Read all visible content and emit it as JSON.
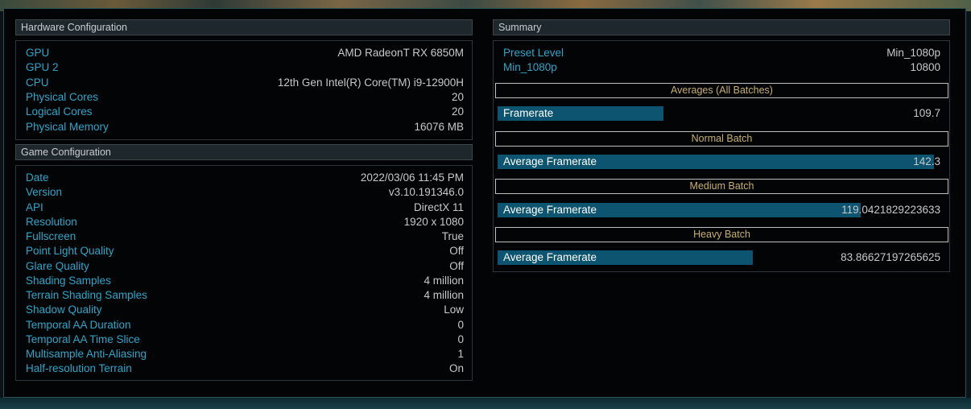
{
  "hardware": {
    "title": "Hardware Configuration",
    "rows": [
      {
        "label": "GPU",
        "value": "AMD RadeonT RX 6850M"
      },
      {
        "label": "GPU 2",
        "value": ""
      },
      {
        "label": "CPU",
        "value": "12th Gen Intel(R) Core(TM) i9-12900H"
      },
      {
        "label": "Physical Cores",
        "value": "20"
      },
      {
        "label": "Logical Cores",
        "value": "20"
      },
      {
        "label": "Physical Memory",
        "value": "16076 MB"
      }
    ]
  },
  "game": {
    "title": "Game Configuration",
    "rows": [
      {
        "label": "Date",
        "value": "2022/03/06 11:45 PM"
      },
      {
        "label": "Version",
        "value": "v3.10.191346.0"
      },
      {
        "label": "API",
        "value": "DirectX 11"
      },
      {
        "label": "Resolution",
        "value": "1920 x 1080"
      },
      {
        "label": "Fullscreen",
        "value": "True"
      },
      {
        "label": "Point Light Quality",
        "value": "Off"
      },
      {
        "label": "Glare Quality",
        "value": "Off"
      },
      {
        "label": "Shading Samples",
        "value": "4 million"
      },
      {
        "label": "Terrain Shading Samples",
        "value": "4 million"
      },
      {
        "label": "Shadow Quality",
        "value": "Low"
      },
      {
        "label": "Temporal AA Duration",
        "value": "0"
      },
      {
        "label": "Temporal AA Time Slice",
        "value": "0"
      },
      {
        "label": "Multisample Anti-Aliasing",
        "value": "1"
      },
      {
        "label": "Half-resolution Terrain",
        "value": "On"
      }
    ]
  },
  "summary": {
    "title": "Summary",
    "rows": [
      {
        "label": "Preset Level",
        "value": "Min_1080p"
      },
      {
        "label": "Min_1080p",
        "value": "10800"
      }
    ],
    "sections": [
      {
        "heading": "Averages (All Batches)",
        "label": "Framerate",
        "value": "109.7",
        "fill_pct": 37.5
      },
      {
        "heading": "Normal Batch",
        "label": "Average Framerate",
        "value": "142.3",
        "fill_pct": 98.5
      },
      {
        "heading": "Medium Batch",
        "label": "Average Framerate",
        "value": "119.0421829223633",
        "fill_pct": 82
      },
      {
        "heading": "Heavy Batch",
        "label": "Average Framerate",
        "value": "83.86627197265625",
        "fill_pct": 57.6
      }
    ]
  }
}
